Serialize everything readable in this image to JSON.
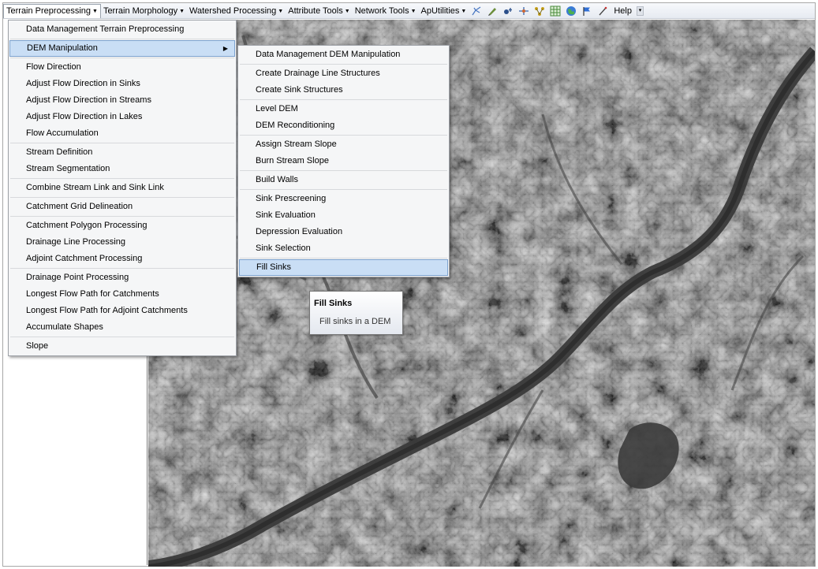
{
  "toolbar": {
    "menus": [
      {
        "label": "Terrain Preprocessing",
        "arrow": "▼"
      },
      {
        "label": "Terrain Morphology",
        "arrow": "▼"
      },
      {
        "label": "Watershed Processing",
        "arrow": "▼"
      },
      {
        "label": "Attribute Tools",
        "arrow": "▼"
      },
      {
        "label": "Network Tools",
        "arrow": "▼"
      },
      {
        "label": "ApUtilities",
        "arrow": "▼"
      }
    ],
    "help_label": "Help",
    "icons": [
      "stream-tool-icon",
      "pencil-tool-icon",
      "point-add-icon",
      "flow-split-icon",
      "network-icon",
      "grid-icon",
      "globe-icon",
      "flag-icon",
      "edit-line-icon"
    ]
  },
  "main_menu": {
    "items": [
      {
        "label": "Data Management Terrain Preprocessing"
      },
      {
        "label": "DEM Manipulation",
        "has_submenu": true,
        "submenu_arrow": "▶"
      },
      {
        "label": "Flow Direction"
      },
      {
        "label": "Adjust Flow Direction in Sinks"
      },
      {
        "label": "Adjust Flow Direction in Streams"
      },
      {
        "label": "Adjust Flow Direction in Lakes"
      },
      {
        "label": "Flow Accumulation"
      },
      {
        "label": "Stream Definition"
      },
      {
        "label": "Stream Segmentation"
      },
      {
        "label": "Combine Stream Link and Sink Link"
      },
      {
        "label": "Catchment Grid Delineation"
      },
      {
        "label": "Catchment Polygon Processing"
      },
      {
        "label": "Drainage Line Processing"
      },
      {
        "label": "Adjoint Catchment Processing"
      },
      {
        "label": "Drainage Point Processing"
      },
      {
        "label": "Longest Flow Path for Catchments"
      },
      {
        "label": "Longest Flow Path for Adjoint Catchments"
      },
      {
        "label": "Accumulate Shapes"
      },
      {
        "label": "Slope"
      }
    ]
  },
  "sub_menu": {
    "items": [
      {
        "label": "Data Management DEM Manipulation"
      },
      {
        "label": "Create Drainage Line Structures"
      },
      {
        "label": "Create Sink Structures"
      },
      {
        "label": "Level DEM"
      },
      {
        "label": "DEM Reconditioning"
      },
      {
        "label": "Assign Stream Slope"
      },
      {
        "label": "Burn Stream Slope"
      },
      {
        "label": "Build Walls"
      },
      {
        "label": "Sink Prescreening"
      },
      {
        "label": "Sink Evaluation"
      },
      {
        "label": "Depression Evaluation"
      },
      {
        "label": "Sink Selection"
      },
      {
        "label": "Fill Sinks"
      }
    ]
  },
  "tooltip": {
    "title": "Fill Sinks",
    "description": "Fill sinks in a DEM"
  },
  "colors": {
    "menu_highlight": "#c9def5",
    "menu_highlight_border": "#7da2ce",
    "menu_background": "#f5f6f7"
  }
}
